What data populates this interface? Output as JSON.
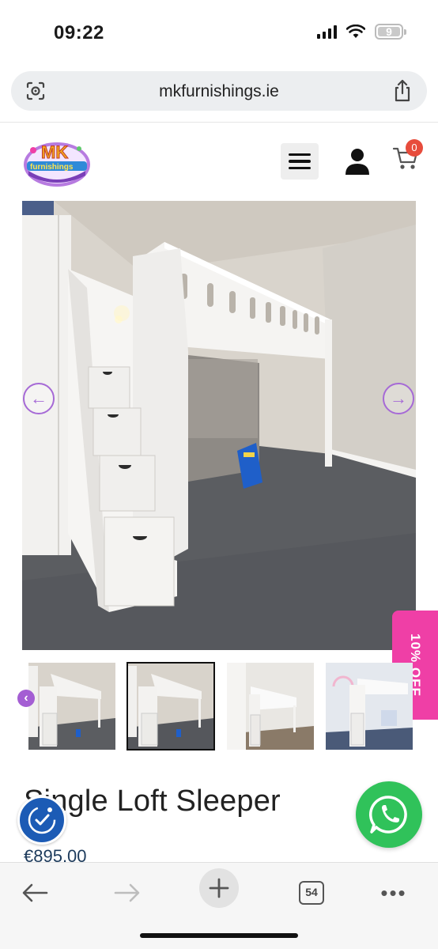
{
  "status_bar": {
    "time": "09:22",
    "battery": "9",
    "icons": [
      "signal-icon",
      "wifi-icon",
      "battery-icon"
    ]
  },
  "browser": {
    "address": "mkfurnishings.ie",
    "icons": [
      "lens-icon",
      "share-icon"
    ]
  },
  "header": {
    "logo_text": "MK furnishings",
    "cart_count": "0",
    "icons": [
      "menu-icon",
      "user-icon",
      "cart-icon"
    ]
  },
  "gallery": {
    "prev_arrow": "←",
    "next_arrow": "→",
    "thumb_prev": "‹",
    "thumbnails": 4,
    "active_thumbnail": 2
  },
  "promo": {
    "label": "10% OFF",
    "color": "#ef3fa6"
  },
  "product": {
    "title": "Single Loft Sleeper",
    "price": "€895.00"
  },
  "toolbar": {
    "tabs_count": "54",
    "more": "•••",
    "icons": [
      "back-arrow-icon",
      "forward-arrow-icon",
      "new-tab-icon",
      "tabs-icon",
      "more-icon"
    ]
  },
  "colors": {
    "accent_purple": "#a66ad6",
    "whatsapp_green": "#30c25a",
    "price_navy": "#1d3b5c",
    "cart_badge": "#e74c3c"
  }
}
